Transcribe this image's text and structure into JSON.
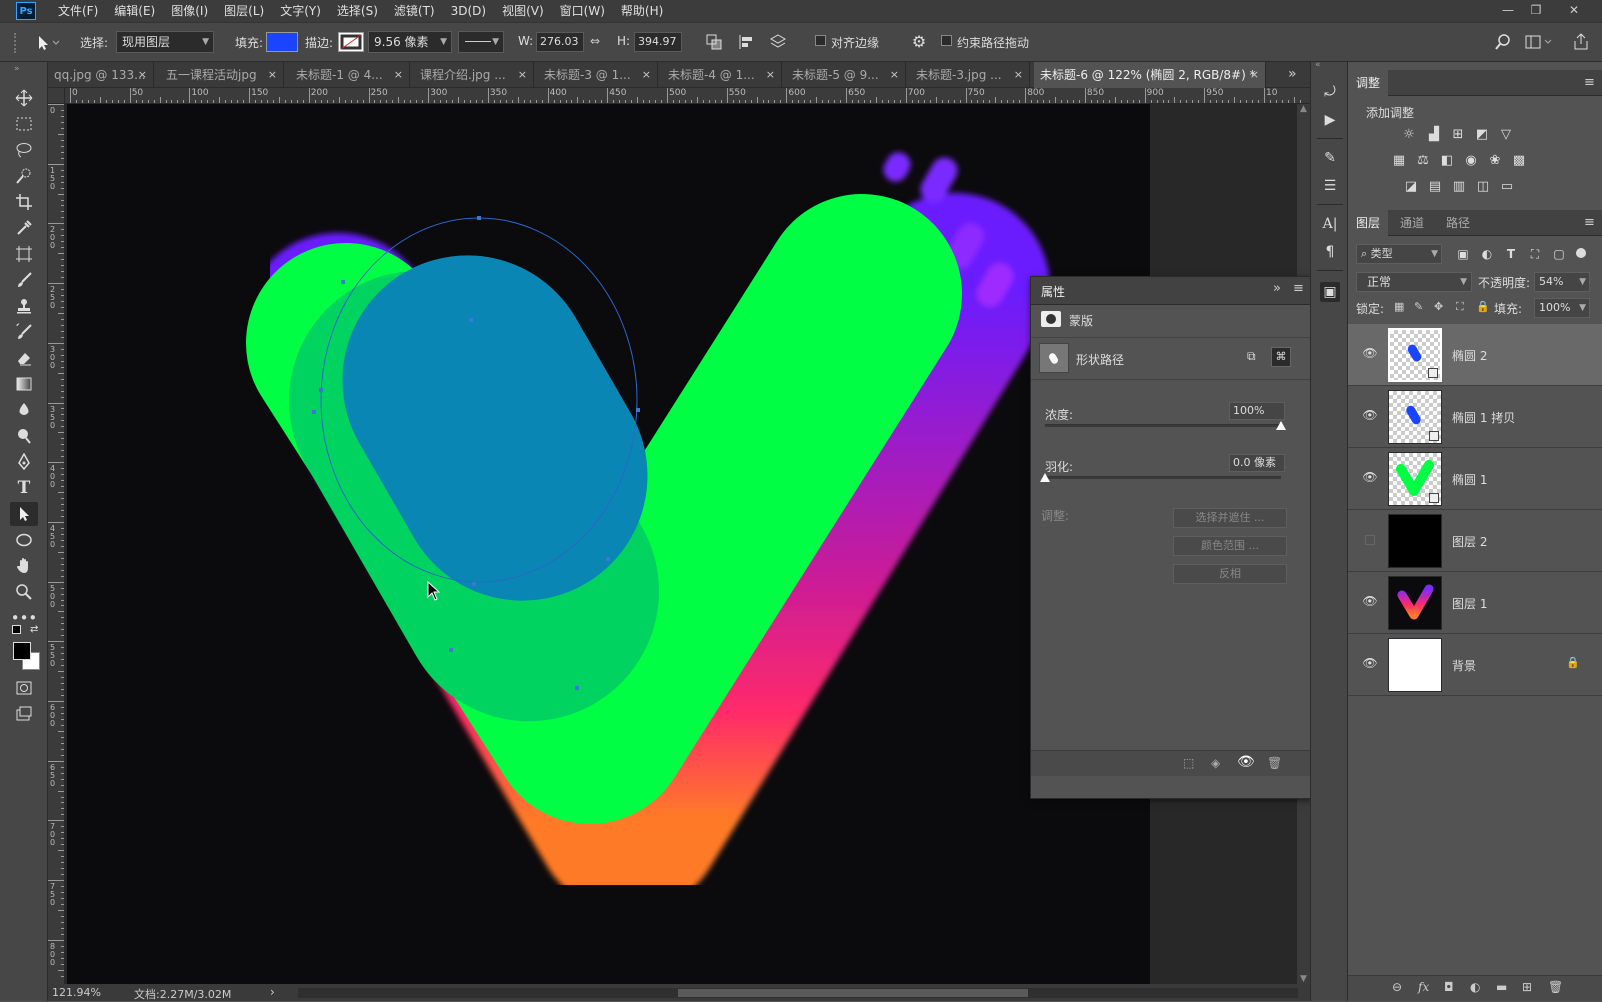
{
  "app": {
    "logo": "Ps"
  },
  "menu": [
    "文件(F)",
    "编辑(E)",
    "图像(I)",
    "图层(L)",
    "文字(Y)",
    "选择(S)",
    "滤镜(T)",
    "3D(D)",
    "视图(V)",
    "窗口(W)",
    "帮助(H)"
  ],
  "window_controls": {
    "minimize": "—",
    "restore": "❐",
    "close": "✕"
  },
  "options": {
    "select_label": "选择:",
    "select_value": "现用图层",
    "fill_label": "填充:",
    "fill_color": "#1a44ff",
    "stroke_label": "描边:",
    "stroke_width": "9.56 像素",
    "w_label": "W:",
    "w_value": "276.03",
    "link_icon": "⇔",
    "h_label": "H:",
    "h_value": "394.97",
    "align_edges": "对齐边缘",
    "constrain_path": "约束路径拖动"
  },
  "tabs": [
    {
      "label": "qq.jpg @ 133...",
      "close": "×"
    },
    {
      "label": "五一课程活动jpg",
      "close": "×"
    },
    {
      "label": "未标题-1 @ 4...",
      "close": "×"
    },
    {
      "label": "课程介绍.jpg ...",
      "close": "×"
    },
    {
      "label": "未标题-3 @ 1...",
      "close": "×"
    },
    {
      "label": "未标题-4 @ 1...",
      "close": "×"
    },
    {
      "label": "未标题-5 @ 9...",
      "close": "×"
    },
    {
      "label": "未标题-3.jpg ...",
      "close": "×"
    },
    {
      "label": "未标题-6 @ 122% (椭圆 2, RGB/8#) *",
      "close": "×"
    }
  ],
  "tabs_overflow": "»",
  "ruler_h": [
    "0",
    "50",
    "100",
    "150",
    "200",
    "250",
    "300",
    "350",
    "400",
    "450",
    "500",
    "550",
    "600",
    "650",
    "700",
    "750",
    "800",
    "850",
    "900",
    "950",
    "10"
  ],
  "ruler_v": [
    "0",
    "1 5 0",
    "2 0 0",
    "2 5 0",
    "3 0 0",
    "3 5 0",
    "4 0 0",
    "4 5 0",
    "5 0 0",
    "5 5 0",
    "6 0 0",
    "6 5 0",
    "7 0 0",
    "7 5 0",
    "8 0 0"
  ],
  "status": {
    "zoom": "121.94%",
    "doc": "文档:2.27M/3.02M",
    "arrow": "›"
  },
  "properties": {
    "title": "属性",
    "expand": "»",
    "menu": "≡",
    "mask_label": "蒙版",
    "shape_path": "形状路径",
    "density_label": "浓度:",
    "density_value": "100%",
    "density_fraction": 1.0,
    "feather_label": "羽化:",
    "feather_value": "0.0 像素",
    "feather_fraction": 0.0,
    "adjust_label": "调整:",
    "btn_select_mask": "选择并遮住 ...",
    "btn_color_range": "颜色范围 ...",
    "btn_invert": "反相"
  },
  "adjustments": {
    "tab": "调整",
    "add_label": "添加调整"
  },
  "layers_panel": {
    "tabs": [
      "图层",
      "通道",
      "路径"
    ],
    "filter_value": "类型",
    "blend_mode": "正常",
    "opacity_label": "不透明度:",
    "opacity_value": "54%",
    "lock_label": "锁定:",
    "fill_label": "填充:",
    "fill_value": "100%",
    "layers": [
      {
        "name": "椭圆 2",
        "visible": true,
        "selected": true
      },
      {
        "name": "椭圆 1 拷贝",
        "visible": true,
        "selected": false
      },
      {
        "name": "椭圆 1",
        "visible": true,
        "selected": false
      },
      {
        "name": "图层 2",
        "visible": false,
        "selected": false
      },
      {
        "name": "图层 1",
        "visible": true,
        "selected": false
      },
      {
        "name": "背景",
        "visible": true,
        "selected": false,
        "locked": true
      }
    ],
    "bottom": [
      "⊖",
      "fx",
      "◘",
      "◐",
      "▬",
      "⊞",
      "🗑"
    ]
  },
  "colors": {
    "green": "#00ff44",
    "blue": "#0a86b4",
    "mint": "#00d35f",
    "panel": "#535353"
  }
}
